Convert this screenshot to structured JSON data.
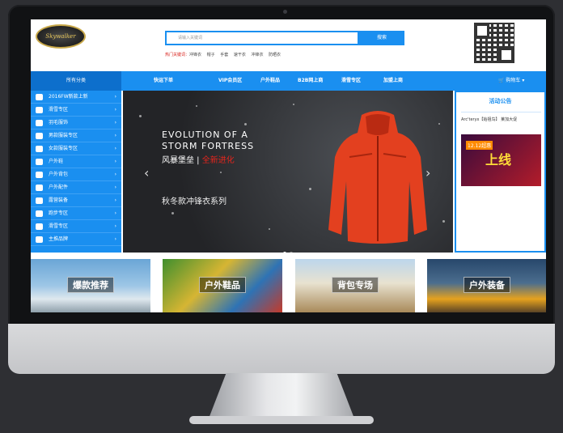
{
  "header": {
    "logo_text": "Skywalker",
    "search_placeholder": "请输入关键词",
    "search_button": "搜索",
    "hot_label": "热门关键词：",
    "hot_keywords": [
      "冲锋衣",
      "帽子",
      "手套",
      "速干衣",
      "冲锋衣",
      "防晒衣"
    ]
  },
  "nav": {
    "category_label": "所有分类",
    "items": [
      "快运下单",
      "VIP会员区",
      "户外鞋品",
      "B2B网上商",
      "滑雪专区",
      "加盟上商"
    ],
    "cart_label": "购物车"
  },
  "sidebar": {
    "items": [
      {
        "label": "2016FW新款上新",
        "icon": "tag-icon"
      },
      {
        "label": "滑雪专区",
        "icon": "ski-icon"
      },
      {
        "label": "羽毛服饰",
        "icon": "feather-icon"
      },
      {
        "label": "男款服装专区",
        "icon": "male-icon"
      },
      {
        "label": "女款服装专区",
        "icon": "female-icon"
      },
      {
        "label": "户外鞋",
        "icon": "shoe-icon"
      },
      {
        "label": "户外背包",
        "icon": "backpack-icon"
      },
      {
        "label": "户外配件",
        "icon": "accessory-icon"
      },
      {
        "label": "露营装备",
        "icon": "tent-icon"
      },
      {
        "label": "跑步专区",
        "icon": "running-icon"
      },
      {
        "label": "滑雪专区",
        "icon": "snowboard-icon"
      },
      {
        "label": "主推品牌",
        "icon": "brand-icon"
      }
    ]
  },
  "banner": {
    "title_line1": "EVOLUTION OF A",
    "title_line2": "STORM FORTRESS",
    "subtitle_white": "风暴堡垒 | ",
    "subtitle_red": "全新进化",
    "series": "秋冬款冲锋衣系列"
  },
  "notice": {
    "title": "活动公告",
    "text": "Arc'teryx【始祖鸟】 莱加大促",
    "ad_tag": "12.12超惠",
    "ad_big": "上线"
  },
  "tiles": [
    {
      "caption": "爆款推荐"
    },
    {
      "caption": "户外鞋品"
    },
    {
      "caption": "背包专场"
    },
    {
      "caption": "户外装备"
    }
  ],
  "colors": {
    "accent": "#1a8ff0",
    "accent_dark": "#0d6fcc",
    "hot_red": "#d9231d"
  }
}
